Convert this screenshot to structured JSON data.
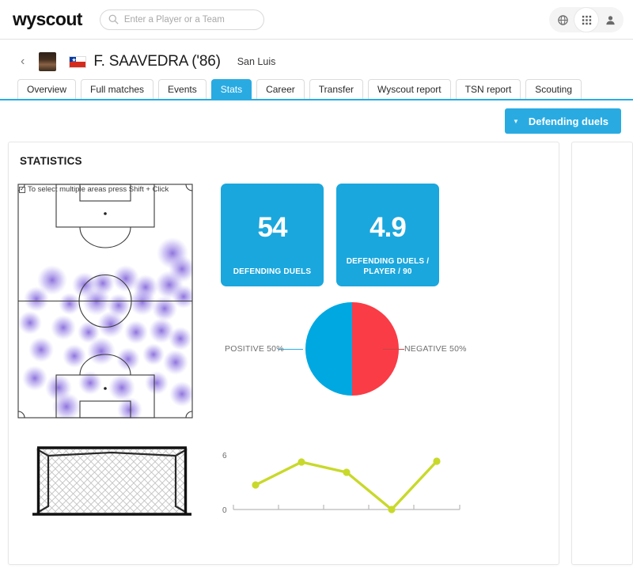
{
  "brand": "wyscout",
  "search": {
    "placeholder": "Enter a Player or a Team",
    "value": "",
    "icon": "search-icon"
  },
  "header_icons": [
    {
      "name": "globe-icon",
      "glyph": "◍"
    },
    {
      "name": "apps-grid-icon",
      "glyph": "▦"
    },
    {
      "name": "user-account-icon",
      "glyph": "👤"
    }
  ],
  "player": {
    "back": "‹",
    "name": "F. SAAVEDRA ('86)",
    "team": "San Luis",
    "country": "Chile"
  },
  "tabs": [
    {
      "label": "Overview",
      "active": false
    },
    {
      "label": "Full matches",
      "active": false
    },
    {
      "label": "Events",
      "active": false
    },
    {
      "label": "Stats",
      "active": true
    },
    {
      "label": "Career",
      "active": false
    },
    {
      "label": "Transfer",
      "active": false
    },
    {
      "label": "Wyscout report",
      "active": false
    },
    {
      "label": "TSN report",
      "active": false
    },
    {
      "label": "Scouting",
      "active": false
    }
  ],
  "filter": {
    "label": "Defending duels",
    "caret": "▼"
  },
  "panel": {
    "title": "STATISTICS"
  },
  "pitch": {
    "hint": "To select multiple areas press Shift + Click",
    "heat_color": "#8c7ae6"
  },
  "cards": [
    {
      "value": "54",
      "label": "DEFENDING DUELS"
    },
    {
      "value": "4.9",
      "label": "DEFENDING DUELS / PLAYER / 90"
    }
  ],
  "colors": {
    "accent_blue": "#29abe2",
    "card_blue": "#1aa7dd",
    "pie_positive": "#00a8e1",
    "pie_negative": "#fa3c46",
    "line": "#c8d92a"
  },
  "chart_data": [
    {
      "type": "pie",
      "title": "",
      "labels": [
        "POSITIVE 50%",
        "NEGATIVE 50%"
      ],
      "slice_names": [
        "POSITIVE",
        "NEGATIVE"
      ],
      "values": [
        50,
        50
      ],
      "unit": "%",
      "colors": [
        "#00a8e1",
        "#fa3c46"
      ],
      "legend_position": "sides",
      "annotations": [
        "POSITIVE 50%",
        "NEGATIVE 50%"
      ]
    },
    {
      "type": "line",
      "title": "",
      "xlabel": "",
      "ylabel": "",
      "x": [
        1,
        2,
        3,
        4,
        5
      ],
      "values": [
        2.7,
        5.2,
        4.1,
        0.0,
        5.3
      ],
      "ylim": [
        0,
        6
      ],
      "ytick_labels": [
        "0",
        "6"
      ],
      "yticks": [
        0,
        6
      ],
      "xtick_labels": [
        "",
        "",
        "",
        "",
        "",
        ""
      ],
      "grid": false,
      "line_color": "#c8d92a",
      "marker": "circle",
      "legend_position": "none"
    }
  ]
}
